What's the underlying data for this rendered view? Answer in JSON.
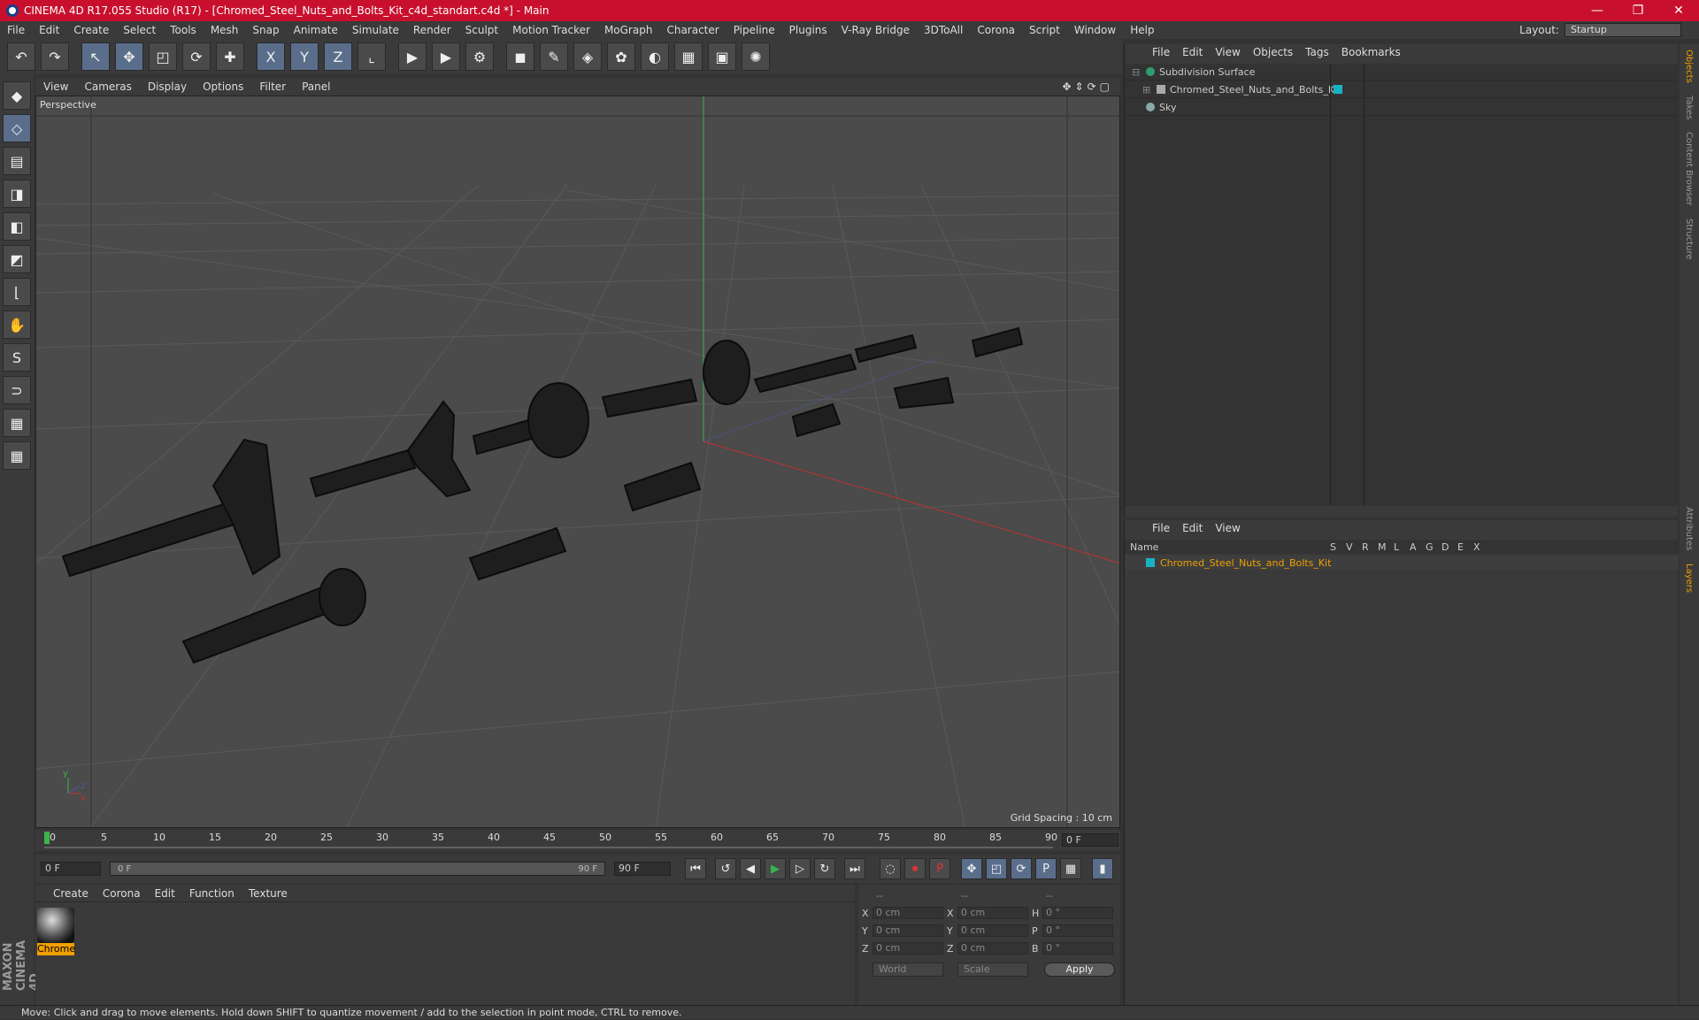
{
  "window": {
    "title": "CINEMA 4D R17.055 Studio (R17) - [Chromed_Steel_Nuts_and_Bolts_Kit_c4d_standart.c4d *] - Main",
    "minimize": "—",
    "restore": "❐",
    "close": "✕"
  },
  "menu": [
    "File",
    "Edit",
    "Create",
    "Select",
    "Tools",
    "Mesh",
    "Snap",
    "Animate",
    "Simulate",
    "Render",
    "Sculpt",
    "Motion Tracker",
    "MoGraph",
    "Character",
    "Pipeline",
    "Plugins",
    "V-Ray Bridge",
    "3DToAll",
    "Corona",
    "Script",
    "Window",
    "Help"
  ],
  "layout": {
    "label": "Layout:",
    "value": "Startup"
  },
  "toolbar": {
    "undo": "↶",
    "redo": "↷",
    "select": "↖",
    "move": "✥",
    "scale": "◰",
    "rotate": "⟳",
    "transform": "✚",
    "x_axis": "X",
    "y_axis": "Y",
    "z_axis": "Z",
    "coord": "⌞",
    "render_view": "▶",
    "render": "▶",
    "render_settings": "⚙",
    "cube": "◼",
    "pen": "✎",
    "subdiv": "◈",
    "array": "✿",
    "deformer": "◐",
    "floor": "▦",
    "camera": "▣",
    "light": "✺"
  },
  "lefttools": [
    "◆",
    "◇",
    "▤",
    "◨",
    "◧",
    "◩",
    "⌊",
    "✋",
    "S",
    "⊃",
    "▦",
    "▦"
  ],
  "brand": "MAXON CINEMA 4D",
  "viewport": {
    "menu": [
      "View",
      "Cameras",
      "Display",
      "Options",
      "Filter",
      "Panel"
    ],
    "nav_icons": "✥⇕⟳▢",
    "label": "Perspective",
    "grid_spacing": "Grid Spacing : 10 cm",
    "axis_y": "y",
    "axis_z": "z",
    "axis_x": "x"
  },
  "timeline": {
    "ticks": [
      "0",
      "5",
      "10",
      "15",
      "20",
      "25",
      "30",
      "35",
      "40",
      "45",
      "50",
      "55",
      "60",
      "65",
      "70",
      "75",
      "80",
      "85",
      "90"
    ],
    "current_frame": "0 F"
  },
  "transport": {
    "start": "0 F",
    "range_start": "0 F",
    "range_end": "90 F",
    "end": "90 F",
    "buttons": [
      "⏮",
      "↺",
      "◀",
      "▶",
      "▷",
      "↻",
      "⏭",
      "◌",
      "⏺",
      "P",
      "✥",
      "◰",
      "⟳",
      "P",
      "▦",
      "▮"
    ]
  },
  "material_panel": {
    "menu": [
      "Create",
      "Corona",
      "Edit",
      "Function",
      "Texture"
    ],
    "material": "Chrome"
  },
  "coords": {
    "header": [
      "--",
      "--",
      "--"
    ],
    "rows": [
      {
        "a": "X",
        "av": "0 cm",
        "b": "X",
        "bv": "0 cm",
        "c": "H",
        "cv": "0 °"
      },
      {
        "a": "Y",
        "av": "0 cm",
        "b": "Y",
        "bv": "0 cm",
        "c": "P",
        "cv": "0 °"
      },
      {
        "a": "Z",
        "av": "0 cm",
        "b": "Z",
        "bv": "0 cm",
        "c": "B",
        "cv": "0 °"
      }
    ],
    "world": "World",
    "scale": "Scale",
    "apply": "Apply"
  },
  "object_manager": {
    "menu": [
      "File",
      "Edit",
      "View",
      "Objects",
      "Tags",
      "Bookmarks"
    ],
    "objects": [
      "Subdivision Surface",
      "Chromed_Steel_Nuts_and_Bolts_Kit",
      "Sky"
    ]
  },
  "layer_manager": {
    "menu": [
      "File",
      "Edit",
      "View"
    ],
    "columns": [
      "Name",
      "S",
      "V",
      "R",
      "M",
      "L",
      "A",
      "G",
      "D",
      "E",
      "X"
    ],
    "layer": "Chromed_Steel_Nuts_and_Bolts_Kit"
  },
  "right_tabs": [
    "Objects",
    "Takes",
    "Content Browser",
    "Structure",
    "Attributes",
    "Layers"
  ],
  "status": "Move: Click and drag to move elements. Hold down SHIFT to quantize movement / add to the selection in point mode, CTRL to remove."
}
